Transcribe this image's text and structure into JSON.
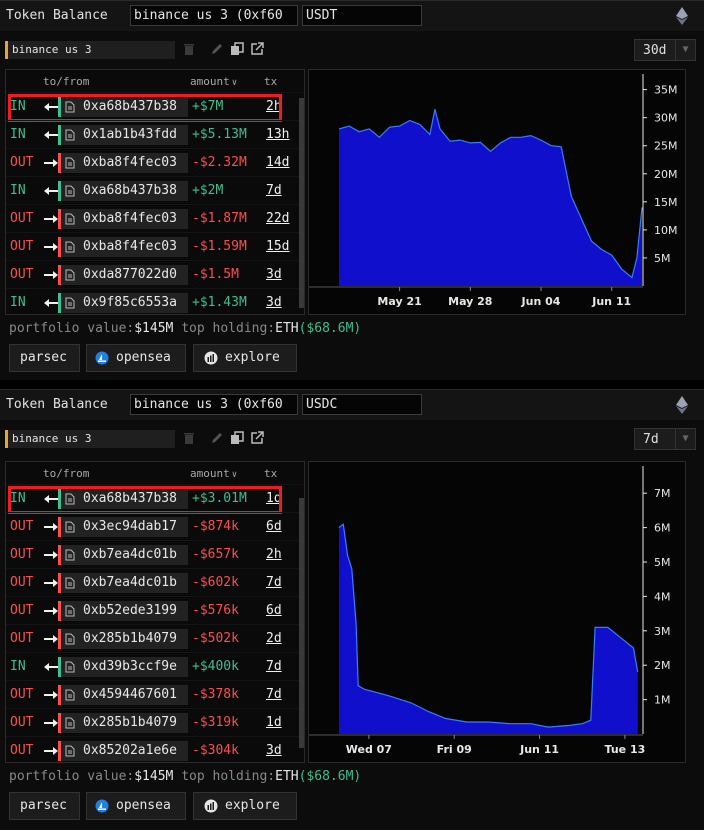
{
  "widgets": [
    {
      "title": "Token Balance",
      "account": "binance us 3 (0xf60",
      "token": "USDT",
      "label": "binance us 3",
      "range": "30d",
      "headers": {
        "to": "to/from",
        "amount": "amount",
        "tx": "tx"
      },
      "rows": [
        {
          "dir": "IN",
          "addr": "0xa68b437b38",
          "amount": "+$7M",
          "tx": "2h"
        },
        {
          "dir": "IN",
          "addr": "0x1ab1b43fdd",
          "amount": "+$5.13M",
          "tx": "13h"
        },
        {
          "dir": "OUT",
          "addr": "0xba8f4fec03",
          "amount": "-$2.32M",
          "tx": "14d"
        },
        {
          "dir": "IN",
          "addr": "0xa68b437b38",
          "amount": "+$2M",
          "tx": "7d"
        },
        {
          "dir": "OUT",
          "addr": "0xba8f4fec03",
          "amount": "-$1.87M",
          "tx": "22d"
        },
        {
          "dir": "OUT",
          "addr": "0xba8f4fec03",
          "amount": "-$1.59M",
          "tx": "15d"
        },
        {
          "dir": "OUT",
          "addr": "0xda877022d0",
          "amount": "-$1.5M",
          "tx": "3d"
        },
        {
          "dir": "IN",
          "addr": "0x9f85c6553a",
          "amount": "+$1.43M",
          "tx": "3d"
        }
      ],
      "portfolio_label": "portfolio value:",
      "portfolio_value": "$145M",
      "holding_label": "top holding:",
      "holding_token": "ETH",
      "holding_value": "($68.6M)",
      "buttons": [
        "parsec",
        "opensea",
        "explore"
      ],
      "chart_data": {
        "type": "area",
        "color": "#1010cc",
        "line_color": "#3a7bff",
        "y_ticks": [
          "5M",
          "10M",
          "15M",
          "20M",
          "25M",
          "30M",
          "35M"
        ],
        "ylim": [
          0,
          36
        ],
        "x_ticks": [
          {
            "label": "May 21",
            "x": 6
          },
          {
            "label": "May 28",
            "x": 13
          },
          {
            "label": "Jun 04",
            "x": 20
          },
          {
            "label": "Jun 11",
            "x": 27
          }
        ],
        "xlim": [
          0,
          30
        ],
        "points": [
          [
            0,
            28
          ],
          [
            1,
            28.5
          ],
          [
            2,
            27.5
          ],
          [
            3,
            28
          ],
          [
            4,
            26.5
          ],
          [
            5,
            28.3
          ],
          [
            6,
            28.5
          ],
          [
            7,
            29.5
          ],
          [
            8,
            28.8
          ],
          [
            9,
            27
          ],
          [
            9.5,
            31.5
          ],
          [
            10,
            28
          ],
          [
            11,
            25.8
          ],
          [
            12,
            26
          ],
          [
            13,
            25.5
          ],
          [
            14,
            25.6
          ],
          [
            15,
            24
          ],
          [
            16,
            25.5
          ],
          [
            17,
            26.5
          ],
          [
            18,
            26.5
          ],
          [
            19,
            26.8
          ],
          [
            20,
            26
          ],
          [
            21,
            25
          ],
          [
            22,
            24.8
          ],
          [
            23,
            16
          ],
          [
            24,
            12
          ],
          [
            25,
            8
          ],
          [
            26,
            6.5
          ],
          [
            27,
            5.5
          ],
          [
            28,
            3
          ],
          [
            29,
            1.5
          ],
          [
            29.5,
            5
          ],
          [
            30,
            14
          ]
        ]
      }
    },
    {
      "title": "Token Balance",
      "account": "binance us 3 (0xf60",
      "token": "USDC",
      "label": "binance us 3",
      "range": "7d",
      "headers": {
        "to": "to/from",
        "amount": "amount",
        "tx": "tx"
      },
      "rows": [
        {
          "dir": "IN",
          "addr": "0xa68b437b38",
          "amount": "+$3.01M",
          "tx": "1d"
        },
        {
          "dir": "OUT",
          "addr": "0x3ec94dab17",
          "amount": "-$874k",
          "tx": "6d"
        },
        {
          "dir": "OUT",
          "addr": "0xb7ea4dc01b",
          "amount": "-$657k",
          "tx": "2h"
        },
        {
          "dir": "OUT",
          "addr": "0xb7ea4dc01b",
          "amount": "-$602k",
          "tx": "7d"
        },
        {
          "dir": "OUT",
          "addr": "0xb52ede3199",
          "amount": "-$576k",
          "tx": "6d"
        },
        {
          "dir": "OUT",
          "addr": "0x285b1b4079",
          "amount": "-$502k",
          "tx": "2d"
        },
        {
          "dir": "IN",
          "addr": "0xd39b3ccf9e",
          "amount": "+$400k",
          "tx": "7d"
        },
        {
          "dir": "OUT",
          "addr": "0x4594467601",
          "amount": "-$378k",
          "tx": "7d"
        },
        {
          "dir": "OUT",
          "addr": "0x285b1b4079",
          "amount": "-$319k",
          "tx": "1d"
        },
        {
          "dir": "OUT",
          "addr": "0x85202a1e6e",
          "amount": "-$304k",
          "tx": "3d"
        }
      ],
      "portfolio_label": "portfolio value:",
      "portfolio_value": "$145M",
      "holding_label": "top holding:",
      "holding_token": "ETH",
      "holding_value": "($68.6M)",
      "buttons": [
        "parsec",
        "opensea",
        "explore"
      ],
      "chart_data": {
        "type": "area",
        "color": "#1010cc",
        "line_color": "#3a7bff",
        "y_ticks": [
          "1M",
          "2M",
          "3M",
          "4M",
          "5M",
          "6M",
          "7M"
        ],
        "ylim": [
          0,
          7.5
        ],
        "x_ticks": [
          {
            "label": "Wed 07",
            "x": 1
          },
          {
            "label": "Fri 09",
            "x": 3
          },
          {
            "label": "Jun 11",
            "x": 5
          },
          {
            "label": "Tue 13",
            "x": 7
          }
        ],
        "xlim": [
          0.3,
          7.4
        ],
        "points": [
          [
            0.3,
            6
          ],
          [
            0.4,
            6.1
          ],
          [
            0.5,
            5.2
          ],
          [
            0.6,
            4.8
          ],
          [
            0.7,
            3.2
          ],
          [
            0.75,
            1.4
          ],
          [
            0.9,
            1.3
          ],
          [
            1.2,
            1.2
          ],
          [
            1.5,
            1.1
          ],
          [
            2,
            0.9
          ],
          [
            2.4,
            0.65
          ],
          [
            2.8,
            0.45
          ],
          [
            3.3,
            0.35
          ],
          [
            3.8,
            0.35
          ],
          [
            4.3,
            0.3
          ],
          [
            4.8,
            0.3
          ],
          [
            5.2,
            0.2
          ],
          [
            5.7,
            0.25
          ],
          [
            6,
            0.3
          ],
          [
            6.2,
            0.4
          ],
          [
            6.3,
            3.1
          ],
          [
            6.6,
            3.1
          ],
          [
            6.9,
            2.8
          ],
          [
            7.2,
            2.5
          ],
          [
            7.3,
            1.8
          ]
        ]
      }
    }
  ]
}
